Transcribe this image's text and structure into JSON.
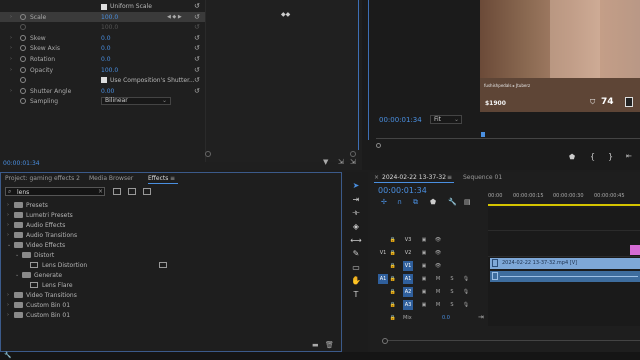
{
  "effect_controls": {
    "uniform_scale_label": "Uniform Scale",
    "properties": [
      {
        "name": "Scale",
        "value": "100.0",
        "selected": true
      },
      {
        "name": "",
        "value": "100.0",
        "dim": true
      },
      {
        "name": "Skew",
        "value": "0.0"
      },
      {
        "name": "Skew Axis",
        "value": "0.0"
      },
      {
        "name": "Rotation",
        "value": "0.0"
      },
      {
        "name": "Opacity",
        "value": "100.0"
      },
      {
        "name": "",
        "value": ""
      },
      {
        "name": "Shutter Angle",
        "value": "0.00"
      },
      {
        "name": "Sampling",
        "value": ""
      }
    ],
    "composition_shutter_label": "Use Composition's Shutter...",
    "sampling_value": "Bilinear",
    "timecode": "00:00:01:34"
  },
  "program_monitor": {
    "timecode": "00:00:01:34",
    "fit_label": "Fit",
    "game_hud": {
      "money": "$1900",
      "ammo": "74",
      "player_line": "fushishpedals ▸ Jtuberz"
    }
  },
  "effects_panel": {
    "tabs": [
      {
        "label": "Project: gaming effects 2",
        "active": false
      },
      {
        "label": "Media Browser",
        "active": false
      },
      {
        "label": "Effects",
        "active": true
      }
    ],
    "search_value": "lens",
    "tree": [
      {
        "label": "Presets",
        "depth": 0,
        "open": false
      },
      {
        "label": "Lumetri Presets",
        "depth": 0,
        "open": false
      },
      {
        "label": "Audio Effects",
        "depth": 0,
        "open": false
      },
      {
        "label": "Audio Transitions",
        "depth": 0,
        "open": false
      },
      {
        "label": "Video Effects",
        "depth": 0,
        "open": true
      },
      {
        "label": "Distort",
        "depth": 1,
        "open": true
      },
      {
        "label": "Lens Distortion",
        "depth": 2,
        "item": true,
        "accel": true
      },
      {
        "label": "Generate",
        "depth": 1,
        "open": true
      },
      {
        "label": "Lens Flare",
        "depth": 2,
        "item": true
      },
      {
        "label": "Video Transitions",
        "depth": 0,
        "open": false
      },
      {
        "label": "Custom Bin 01",
        "depth": 0,
        "open": false
      },
      {
        "label": "Custom Bin 01",
        "depth": 0,
        "open": false
      }
    ]
  },
  "timeline": {
    "tab_label": "2024-02-22 13-37-32",
    "sequence_tab": "Sequence 01",
    "timecode": "00:00:01:34",
    "ruler": [
      "00:00",
      "00:00:00:15",
      "00:00:00:30",
      "00:00:00:45"
    ],
    "video_tracks": [
      "V3",
      "V2",
      "V1"
    ],
    "source_video": "V1",
    "audio_tracks": [
      "A1",
      "A2",
      "A3"
    ],
    "source_audio": "A1",
    "mix_label": "Mix",
    "mix_value": "0.0",
    "clip_label": "2024-02-22 13-37-32.mp4 [V]"
  },
  "colors": {
    "accent_blue": "#4a8fe0",
    "clip_video": "#7ea8d8",
    "clip_audio": "#3e6d9e",
    "track_on": "#2f5f9c"
  }
}
